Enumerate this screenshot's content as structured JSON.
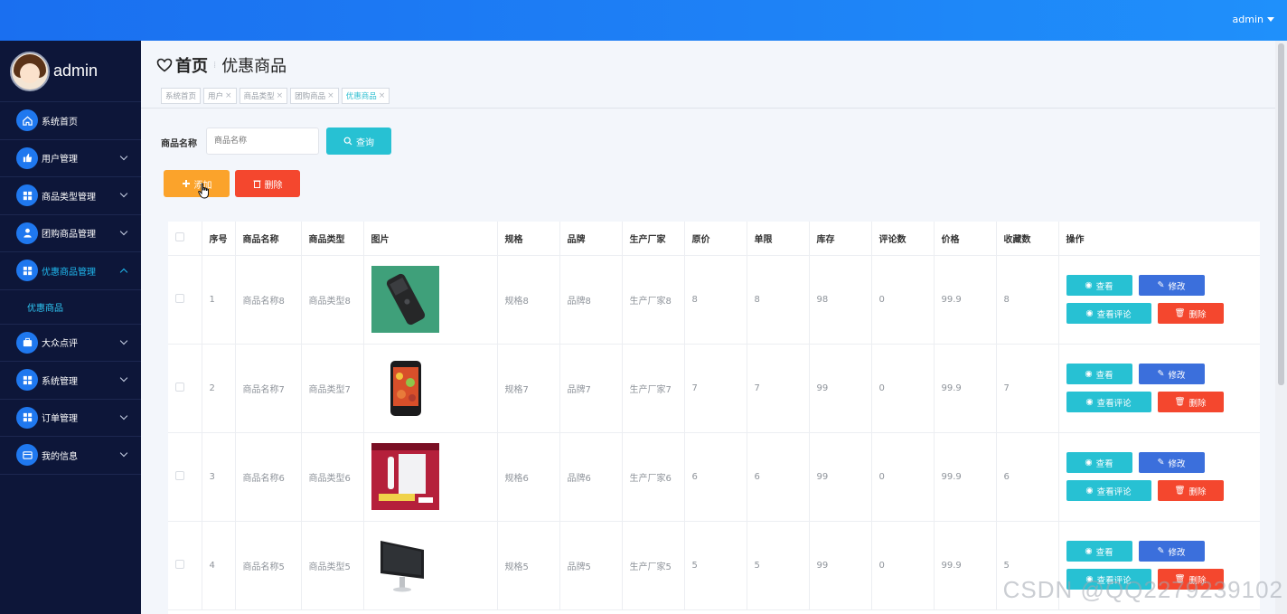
{
  "topbar": {
    "user": "admin"
  },
  "sidebar": {
    "username": "admin",
    "items": [
      {
        "label": "系统首页",
        "icon": "home-icon",
        "expandable": false
      },
      {
        "label": "用户管理",
        "icon": "user-thumb-icon",
        "expandable": true
      },
      {
        "label": "商品类型管理",
        "icon": "grid-icon",
        "expandable": true
      },
      {
        "label": "团购商品管理",
        "icon": "person-icon",
        "expandable": true
      },
      {
        "label": "优惠商品管理",
        "icon": "grid-icon",
        "expandable": true,
        "active": true
      },
      {
        "label": "大众点评",
        "icon": "briefcase-icon",
        "expandable": true
      },
      {
        "label": "系统管理",
        "icon": "grid-icon",
        "expandable": true
      },
      {
        "label": "订单管理",
        "icon": "grid-icon",
        "expandable": true
      },
      {
        "label": "我的信息",
        "icon": "card-icon",
        "expandable": true
      }
    ],
    "submenu": {
      "label": "优惠商品"
    }
  },
  "breadcrumb": {
    "home": "首页",
    "current": "优惠商品"
  },
  "tags": [
    {
      "label": "系统首页",
      "closable": false
    },
    {
      "label": "用户",
      "closable": true
    },
    {
      "label": "商品类型",
      "closable": true
    },
    {
      "label": "团购商品",
      "closable": true
    },
    {
      "label": "优惠商品",
      "closable": true,
      "active": true
    }
  ],
  "search": {
    "label": "商品名称",
    "placeholder": "商品名称",
    "button": "查询"
  },
  "actions": {
    "add": "添加",
    "delete": "删除"
  },
  "table": {
    "headers": [
      "序号",
      "商品名称",
      "商品类型",
      "图片",
      "规格",
      "品牌",
      "生产厂家",
      "原价",
      "单限",
      "库存",
      "评论数",
      "价格",
      "收藏数",
      "操作"
    ],
    "rows": [
      {
        "index": "1",
        "name": "商品名称8",
        "type": "商品类型8",
        "image": "black-phone",
        "spec": "规格8",
        "brand": "品牌8",
        "maker": "生产厂家8",
        "original_price": "8",
        "limit": "8",
        "stock": "98",
        "comments": "0",
        "price": "99.9",
        "favorites": "8"
      },
      {
        "index": "2",
        "name": "商品名称7",
        "type": "商品类型7",
        "image": "smartphone",
        "spec": "规格7",
        "brand": "品牌7",
        "maker": "生产厂家7",
        "original_price": "7",
        "limit": "7",
        "stock": "99",
        "comments": "0",
        "price": "99.9",
        "favorites": "7"
      },
      {
        "index": "3",
        "name": "商品名称6",
        "type": "商品类型6",
        "image": "game-console",
        "spec": "规格6",
        "brand": "品牌6",
        "maker": "生产厂家6",
        "original_price": "6",
        "limit": "6",
        "stock": "99",
        "comments": "0",
        "price": "99.9",
        "favorites": "6"
      },
      {
        "index": "4",
        "name": "商品名称5",
        "type": "商品类型5",
        "image": "desktop-monitor",
        "spec": "规格5",
        "brand": "品牌5",
        "maker": "生产厂家5",
        "original_price": "5",
        "limit": "5",
        "stock": "99",
        "comments": "0",
        "price": "99.9",
        "favorites": "5"
      }
    ],
    "row_actions": {
      "view": "查看",
      "edit": "修改",
      "comments": "查看评论",
      "delete": "删除"
    }
  },
  "watermark": "CSDN @QQ2279239102",
  "colors": {
    "topbar": "#1a6ff0",
    "sidebar": "#0d1639",
    "accent": "#27c1d3",
    "add": "#fba32b",
    "danger": "#f4472e",
    "edit": "#3b6fdc"
  }
}
